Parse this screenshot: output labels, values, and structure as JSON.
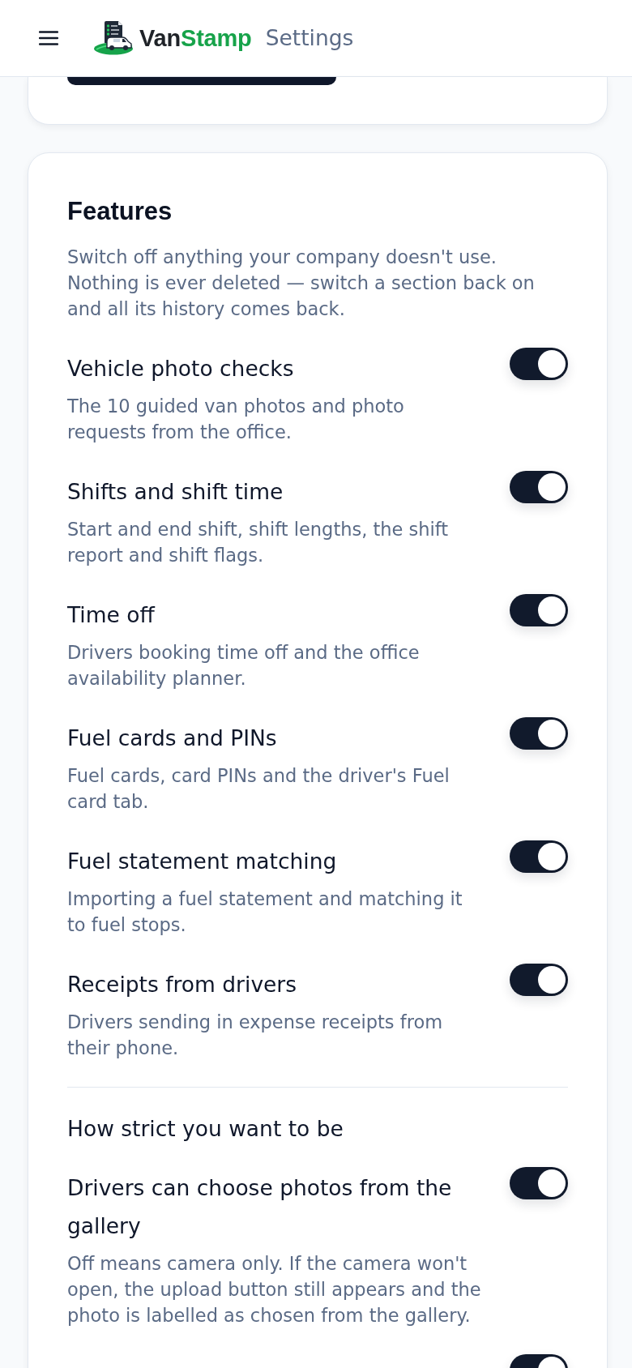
{
  "header": {
    "brand": {
      "first": "Van",
      "second": "Stamp"
    },
    "title": "Settings"
  },
  "features": {
    "title": "Features",
    "description": "Switch off anything your company doesn't use. Nothing is ever deleted — switch a section back on and all its history comes back.",
    "items": [
      {
        "title": "Vehicle photo checks",
        "description": "The 10 guided van photos and photo requests from the office.",
        "on": true
      },
      {
        "title": "Shifts and shift time",
        "description": "Start and end shift, shift lengths, the shift report and shift flags.",
        "on": true
      },
      {
        "title": "Time off",
        "description": "Drivers booking time off and the office availability planner.",
        "on": true
      },
      {
        "title": "Fuel cards and PINs",
        "description": "Fuel cards, card PINs and the driver's Fuel card tab.",
        "on": true
      },
      {
        "title": "Fuel statement matching",
        "description": "Importing a fuel statement and matching it to fuel stops.",
        "on": true
      },
      {
        "title": "Receipts from drivers",
        "description": "Drivers sending in expense receipts from their phone.",
        "on": true
      }
    ]
  },
  "strictness": {
    "heading": "How strict you want to be",
    "items": [
      {
        "title": "Drivers can choose photos from the gallery",
        "description": "Off means camera only. If the camera won't open, the upload button still appears and the photo is labelled as chosen from the gallery.",
        "on": true
      },
      {
        "on": true
      }
    ]
  }
}
